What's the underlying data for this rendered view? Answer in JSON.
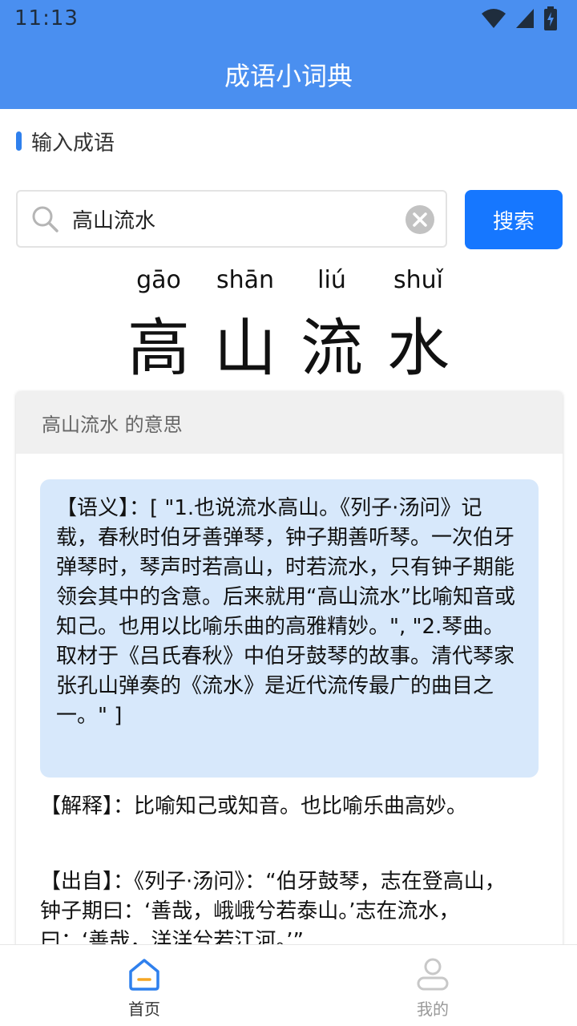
{
  "status_bar": {
    "time": "11:13"
  },
  "header": {
    "title": "成语小词典"
  },
  "section": {
    "label": "输入成语"
  },
  "search": {
    "value": "高山流水",
    "button_label": "搜索"
  },
  "idiom": {
    "pinyin": [
      "gāo",
      "shān",
      "liú",
      "shuǐ"
    ],
    "chars": [
      "高",
      "山",
      "流",
      "水"
    ]
  },
  "card": {
    "header": "高山流水 的意思",
    "meaning": "【语义】：[ \"1.也说流水高山。《列子·汤问》记载，春秋时伯牙善弹琴，钟子期善听琴。一次伯牙弹琴时，琴声时若高山，时若流水，只有钟子期能领会其中的含意。后来就用“高山流水”比喻知音或知己。也用以比喻乐曲的高雅精妙。\", \"2.琴曲。取材于《吕氏春秋》中伯牙鼓琴的故事。清代琴家张孔山弹奏的《流水》是近代流传最广的曲目之一。\" ]",
    "explain": "【解释】：比喻知己或知音。也比喻乐曲高妙。",
    "source": "【出自】：《列子·汤问》：“伯牙鼓琴，志在登高山，钟子期曰：‘善哉，峨峨兮若泰山。’志在流水，曰：‘善哉，洋洋兮若江河。’”"
  },
  "bottom_nav": {
    "home_label": "首页",
    "mine_label": "我的"
  },
  "colors": {
    "accent": "#1677ff",
    "header_bg": "#4a8ff0",
    "meaning_bg": "#d7e8fb"
  }
}
